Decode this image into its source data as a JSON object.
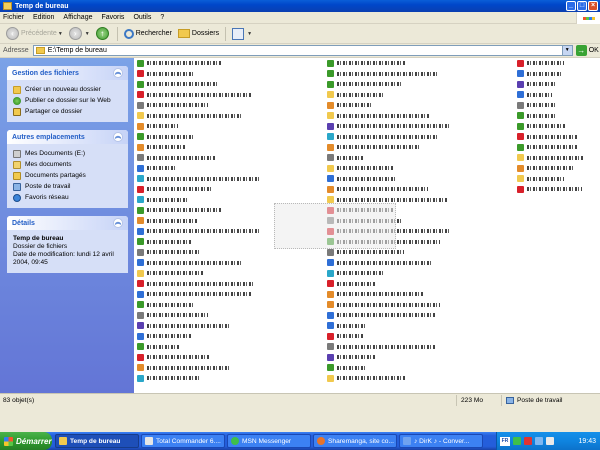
{
  "window": {
    "title": "Temp de bureau"
  },
  "menu": [
    "Fichier",
    "Edition",
    "Affichage",
    "Favoris",
    "Outils",
    "?"
  ],
  "toolbar": {
    "back": "Précédente",
    "search": "Rechercher",
    "folders": "Dossiers"
  },
  "address": {
    "label": "Adresse",
    "value": "E:\\Temp de bureau",
    "go": "OK"
  },
  "taskpane": {
    "file_tasks": {
      "title": "Gestion des fichiers",
      "items": [
        "Créer un nouveau dossier",
        "Publier ce dossier sur le Web",
        "Partager ce dossier"
      ]
    },
    "other_places": {
      "title": "Autres emplacements",
      "items": [
        "Mes Documents (E:)",
        "Mes documents",
        "Documents partagés",
        "Poste de travail",
        "Favoris réseau"
      ]
    },
    "details": {
      "title": "Détails",
      "name": "Temp de bureau",
      "type": "Dossier de fichiers",
      "modified": "Date de modification: lundi 12 avril 2004, 09:45"
    }
  },
  "status": {
    "count": "83 objet(s)",
    "size": "223 Mo",
    "location": "Poste de travail"
  },
  "taskbar": {
    "start": "Démarrer",
    "tasks": [
      "Temp de bureau",
      "Total Commander 6....",
      "MSN Messenger",
      "Sharemanga, site co...",
      "♪ DirK ♪ - Conver..."
    ],
    "clock": "19:43",
    "lang": "FR"
  },
  "colors": {
    "titlebar": "#0047c9",
    "taskpane": "#6f8fe0",
    "taskbar": "#245edb",
    "start": "#2e9a2e"
  }
}
